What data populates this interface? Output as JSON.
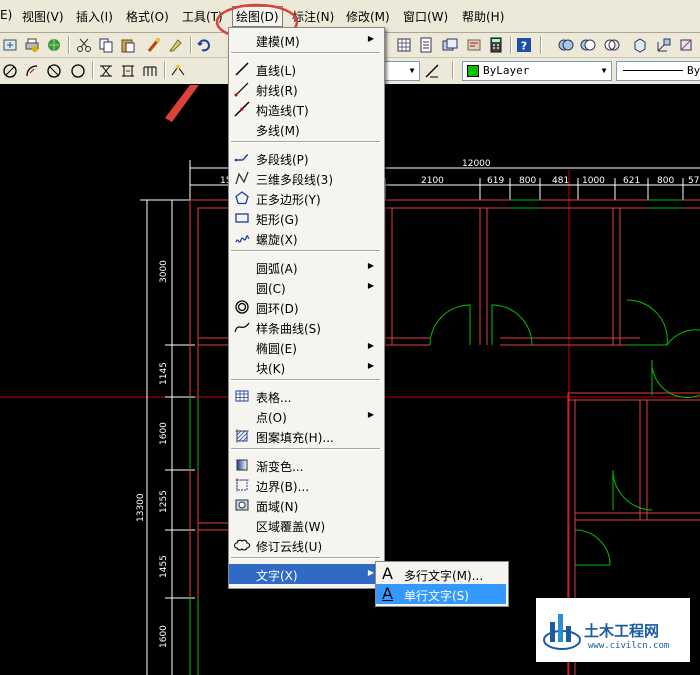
{
  "menubar": {
    "items": [
      {
        "label": "E)"
      },
      {
        "label": "视图(V)"
      },
      {
        "label": "插入(I)"
      },
      {
        "label": "格式(O)"
      },
      {
        "label": "工具(T)"
      },
      {
        "label": "绘图(D)"
      },
      {
        "label": "标注(N)"
      },
      {
        "label": "修改(M)"
      },
      {
        "label": "窗口(W)"
      },
      {
        "label": "帮助(H)"
      }
    ]
  },
  "toolbar": {
    "linetype_combo": "ByLayer",
    "layer_combo_value": "",
    "lineweight_combo_tail": "By"
  },
  "draw_menu": {
    "items": [
      {
        "label": "建模(M)",
        "icon": "none",
        "submenu": true
      },
      {
        "label": "直线(L)",
        "icon": "line-icon"
      },
      {
        "label": "射线(R)",
        "icon": "ray-icon"
      },
      {
        "label": "构造线(T)",
        "icon": "construction-line-icon"
      },
      {
        "label": "多线(M)",
        "icon": "none"
      },
      {
        "label": "多段线(P)",
        "icon": "polyline-icon"
      },
      {
        "label": "三维多段线(3)",
        "icon": "3d-polyline-icon"
      },
      {
        "label": "正多边形(Y)",
        "icon": "polygon-icon"
      },
      {
        "label": "矩形(G)",
        "icon": "rectangle-icon"
      },
      {
        "label": "螺旋(X)",
        "icon": "helix-icon"
      },
      {
        "label": "圆弧(A)",
        "icon": "none",
        "submenu": true
      },
      {
        "label": "圆(C)",
        "icon": "none",
        "submenu": true
      },
      {
        "label": "圆环(D)",
        "icon": "donut-icon"
      },
      {
        "label": "样条曲线(S)",
        "icon": "spline-icon"
      },
      {
        "label": "椭圆(E)",
        "icon": "none",
        "submenu": true
      },
      {
        "label": "块(K)",
        "icon": "none",
        "submenu": true
      },
      {
        "label": "表格...",
        "icon": "table-icon"
      },
      {
        "label": "点(O)",
        "icon": "none",
        "submenu": true
      },
      {
        "label": "图案填充(H)...",
        "icon": "hatch-icon"
      },
      {
        "label": "渐变色...",
        "icon": "gradient-icon"
      },
      {
        "label": "边界(B)...",
        "icon": "boundary-icon"
      },
      {
        "label": "面域(N)",
        "icon": "region-icon"
      },
      {
        "label": "区域覆盖(W)",
        "icon": "none"
      },
      {
        "label": "修订云线(U)",
        "icon": "revcloud-icon"
      },
      {
        "label": "文字(X)",
        "icon": "none",
        "submenu": true,
        "highlighted": true
      }
    ]
  },
  "text_submenu": {
    "items": [
      {
        "label": "多行文字(M)...",
        "icon_glyph": "A",
        "highlighted": false
      },
      {
        "label": "单行文字(S)",
        "icon_glyph": "A",
        "highlighted": true
      }
    ]
  },
  "drawing": {
    "dims_top": [
      "12000",
      "15",
      "2100",
      "619",
      "800",
      "481",
      "1000",
      "621",
      "800",
      "57"
    ],
    "dims_left": [
      "3000",
      "1145",
      "1600",
      "1255",
      "13300",
      "1455",
      "1600"
    ]
  },
  "watermark": {
    "title": "土木工程网",
    "url": "www.civilcn.com"
  },
  "colors": {
    "menubar_bg": "#ece9d8",
    "highlight": "#316ac5",
    "submenu_highlight": "#3399ff",
    "annotation_red": "#e0403a",
    "cad_green": "#00c000",
    "cad_red": "#c00000"
  }
}
